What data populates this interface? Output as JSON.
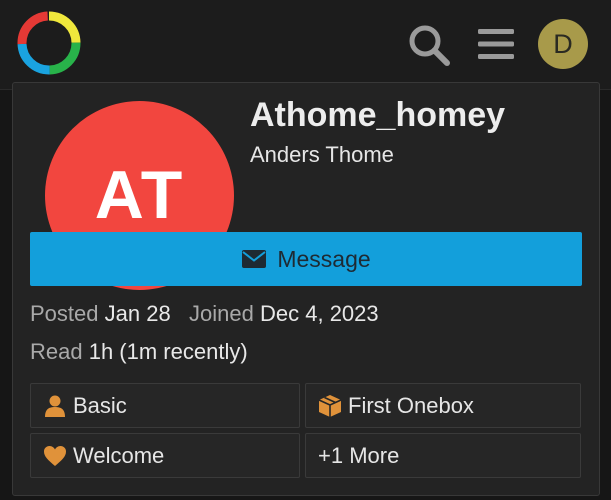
{
  "header": {
    "logo_icon": "discourse-logo-icon",
    "search_icon": "search-icon",
    "menu_icon": "hamburger-menu-icon",
    "user_avatar_letter": "D",
    "user_avatar_color": "#a89a4a"
  },
  "profile": {
    "avatar_initials": "AT",
    "avatar_color": "#f2463f",
    "username": "Athome_homey",
    "full_name": "Anders Thome",
    "message_button": {
      "icon": "envelope-icon",
      "label": "Message",
      "color": "#139fdb"
    },
    "meta": {
      "posted_label": "Posted",
      "posted_value": "Jan 28",
      "joined_label": "Joined",
      "joined_value": "Dec 4, 2023",
      "read_label": "Read",
      "read_value": "1h (1m recently)"
    },
    "badges": [
      {
        "icon": "user-icon",
        "label": "Basic"
      },
      {
        "icon": "cube-icon",
        "label": "First Onebox"
      },
      {
        "icon": "heart-icon",
        "label": "Welcome"
      },
      {
        "icon": "",
        "label": "+1 More"
      }
    ],
    "badge_icon_color": "#e0923a"
  }
}
